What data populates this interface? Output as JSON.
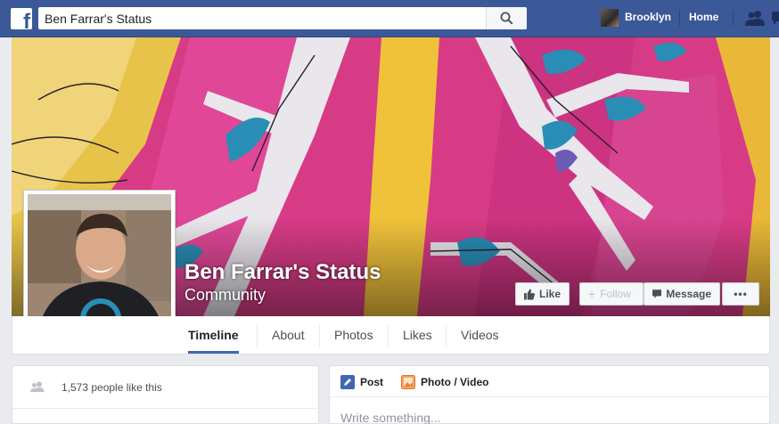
{
  "topbar": {
    "search_value": "Ben Farrar's Status",
    "user_name": "Brooklyn",
    "home_label": "Home"
  },
  "page": {
    "name": "Ben Farrar's Status",
    "category": "Community"
  },
  "cover_actions": {
    "like_label": "Like",
    "follow_label": "Follow",
    "message_label": "Message",
    "more_label": "•••"
  },
  "tabs": [
    {
      "label": "Timeline",
      "active": true
    },
    {
      "label": "About"
    },
    {
      "label": "Photos"
    },
    {
      "label": "Likes"
    },
    {
      "label": "Videos"
    }
  ],
  "sidebar": {
    "likes_count_text": "1,573 people like this"
  },
  "composer": {
    "post_label": "Post",
    "photo_video_label": "Photo / Video",
    "placeholder": "Write something..."
  },
  "colors": {
    "brand": "#3b5998",
    "accent": "#4267b2",
    "cover_pink": "#d93f8a"
  }
}
